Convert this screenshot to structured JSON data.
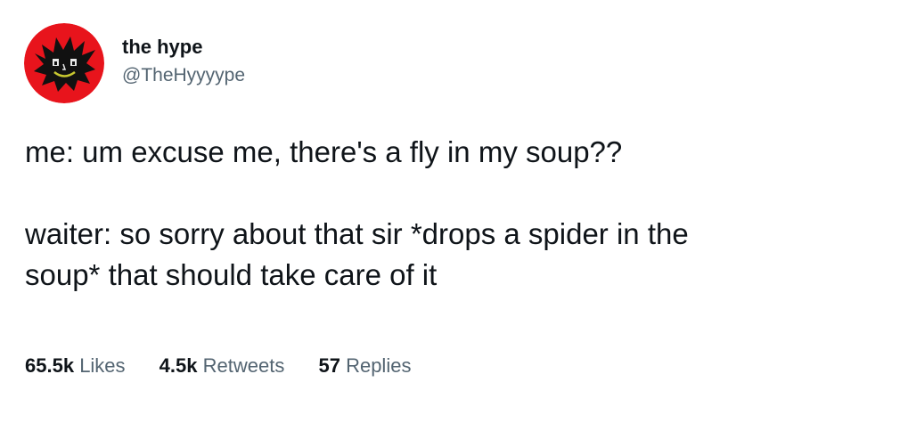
{
  "author": {
    "display_name": "the hype",
    "handle": "@TheHyyyype",
    "avatar_icon": "red-demon-face-avatar"
  },
  "tweet": {
    "lines": [
      "me: um excuse me, there's a fly in my soup??",
      "waiter: so sorry about that sir *drops a spider in the",
      "soup* that should take care of it"
    ]
  },
  "stats": {
    "likes_count": "65.5k",
    "likes_label": "Likes",
    "retweets_count": "4.5k",
    "retweets_label": "Retweets",
    "replies_count": "57",
    "replies_label": "Replies"
  },
  "colors": {
    "text": "#0f1419",
    "secondary_text": "#536471",
    "avatar_red": "#e8141c",
    "background": "#ffffff"
  }
}
